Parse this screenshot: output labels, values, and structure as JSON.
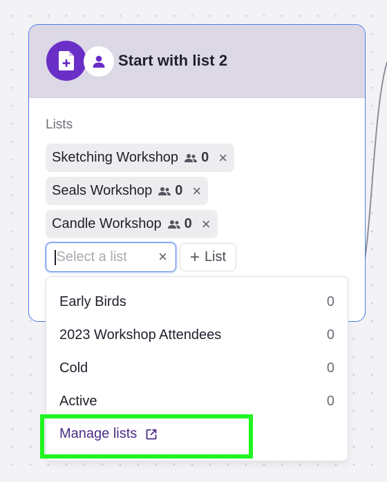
{
  "node": {
    "title": "Start with list 2",
    "header_icon": "list-add-icon",
    "header_badge_icon": "person-icon",
    "accent_color": "#6a2fc7",
    "border_color": "#4b7be5"
  },
  "lists_field": {
    "label": "Lists",
    "selected": [
      {
        "name": "Sketching Workshop",
        "count": "0"
      },
      {
        "name": "Seals Workshop",
        "count": "0"
      },
      {
        "name": "Candle Workshop",
        "count": "0"
      }
    ],
    "select_placeholder": "Select a list",
    "add_button_label": "List"
  },
  "dropdown": {
    "options": [
      {
        "name": "Early Birds",
        "count": "0"
      },
      {
        "name": "2023 Workshop Attendees",
        "count": "0"
      },
      {
        "name": "Cold",
        "count": "0"
      },
      {
        "name": "Active",
        "count": "0"
      }
    ],
    "manage_label": "Manage lists",
    "manage_icon": "external-link-icon"
  },
  "highlight_color": "#1ff51f"
}
